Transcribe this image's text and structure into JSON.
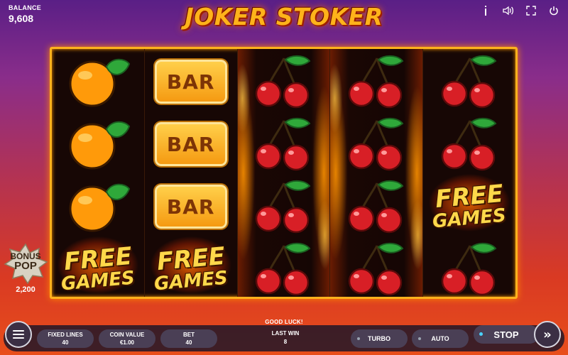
{
  "header": {
    "balance_label": "BALANCE",
    "balance_value": "9,608",
    "logo_text": "JOKER STOKER",
    "icons": [
      "info-icon",
      "sound-icon",
      "fullscreen-icon",
      "power-icon"
    ]
  },
  "reels": [
    [
      "orange",
      "orange",
      "orange",
      "free-games"
    ],
    [
      "bar",
      "bar",
      "bar",
      "free-games"
    ],
    [
      "cherry",
      "cherry",
      "cherry",
      "cherry"
    ],
    [
      "cherry",
      "cherry",
      "cherry",
      "cherry"
    ],
    [
      "cherry",
      "cherry",
      "free-games",
      "cherry"
    ]
  ],
  "symbols": {
    "bar_text": "BAR",
    "free_line1": "FREE",
    "free_line2": "GAMES"
  },
  "bonus": {
    "line1": "BONUS",
    "line2": "POP",
    "amount": "2,200"
  },
  "footer": {
    "message": "GOOD LUCK!",
    "fixed_lines_label": "FIXED LINES",
    "fixed_lines_value": "40",
    "coin_value_label": "COIN VALUE",
    "coin_value_value": "€1.00",
    "bet_label": "BET",
    "bet_value": "40",
    "last_win_label": "LAST WIN",
    "last_win_value": "8",
    "turbo_label": "TURBO",
    "auto_label": "AUTO",
    "stop_label": "STOP"
  },
  "colors": {
    "reel_border": "#ffb21d",
    "cherry": "#d81f26",
    "orange": "#ff9a0a",
    "leaf": "#2fa83a"
  }
}
